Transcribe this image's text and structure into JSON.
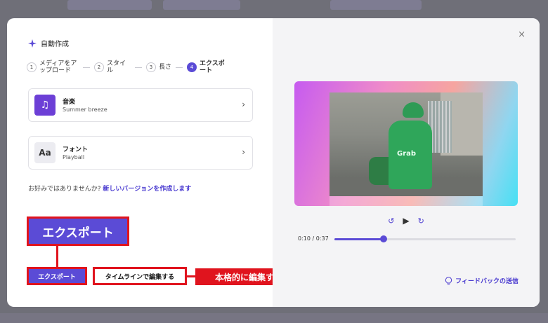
{
  "header": {
    "title": "自動作成",
    "close_symbol": "×"
  },
  "steps": [
    {
      "num": "1",
      "label": "メディアをアップロード"
    },
    {
      "num": "2",
      "label": "スタイル"
    },
    {
      "num": "3",
      "label": "長さ"
    },
    {
      "num": "4",
      "label": "エクスポート"
    }
  ],
  "cards": {
    "music": {
      "title": "音楽",
      "subtitle": "Summer breeze",
      "icon": "music-note-icon"
    },
    "font": {
      "title": "フォント",
      "subtitle": "Playball",
      "thumb_text": "Aa"
    }
  },
  "prompt": {
    "text": "お好みではありませんか?",
    "link": "新しいバージョンを作成します"
  },
  "annotations": {
    "export_big": "エクスポート",
    "callout": "本格的に編集する"
  },
  "buttons": {
    "export": "エクスポート",
    "timeline": "タイムラインで編集する"
  },
  "player": {
    "time": "0:10 / 0:37",
    "progress_fraction": 0.27,
    "video_logo": "Grab"
  },
  "feedback": {
    "label": "フィードバックの送信"
  },
  "colors": {
    "accent": "#5b4bd6",
    "annotation_red": "#e0141e"
  }
}
